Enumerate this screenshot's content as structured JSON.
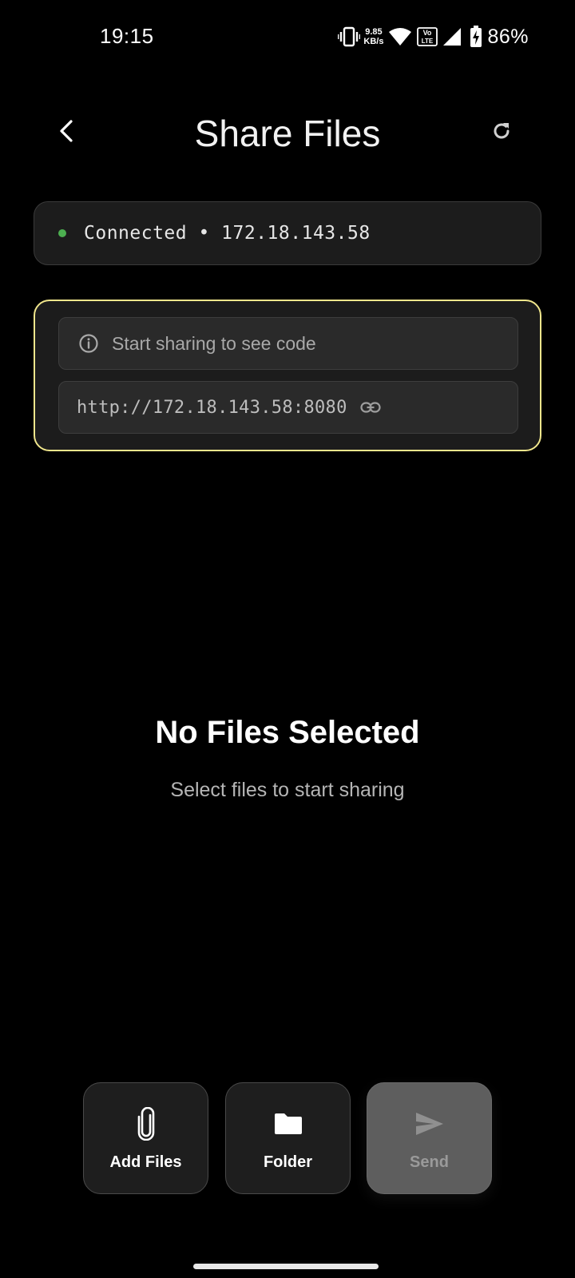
{
  "status_bar": {
    "time": "19:15",
    "net_speed_value": "9.85",
    "net_speed_unit": "KB/s",
    "volte_top": "Vo",
    "volte_bottom": "LTE",
    "battery_percent": "86%"
  },
  "header": {
    "title": "Share Files",
    "back_icon": "chevron-left-icon",
    "refresh_icon": "refresh-icon"
  },
  "connection": {
    "status_color": "#4caf50",
    "text": "Connected • 172.18.143.58"
  },
  "share_panel": {
    "border_color": "#f0e68c",
    "code_hint": "Start sharing to see code",
    "url": "http://172.18.143.58:8080"
  },
  "empty_state": {
    "title": "No Files Selected",
    "subtitle": "Select files to start sharing"
  },
  "actions": {
    "add_files_label": "Add Files",
    "folder_label": "Folder",
    "send_label": "Send"
  }
}
